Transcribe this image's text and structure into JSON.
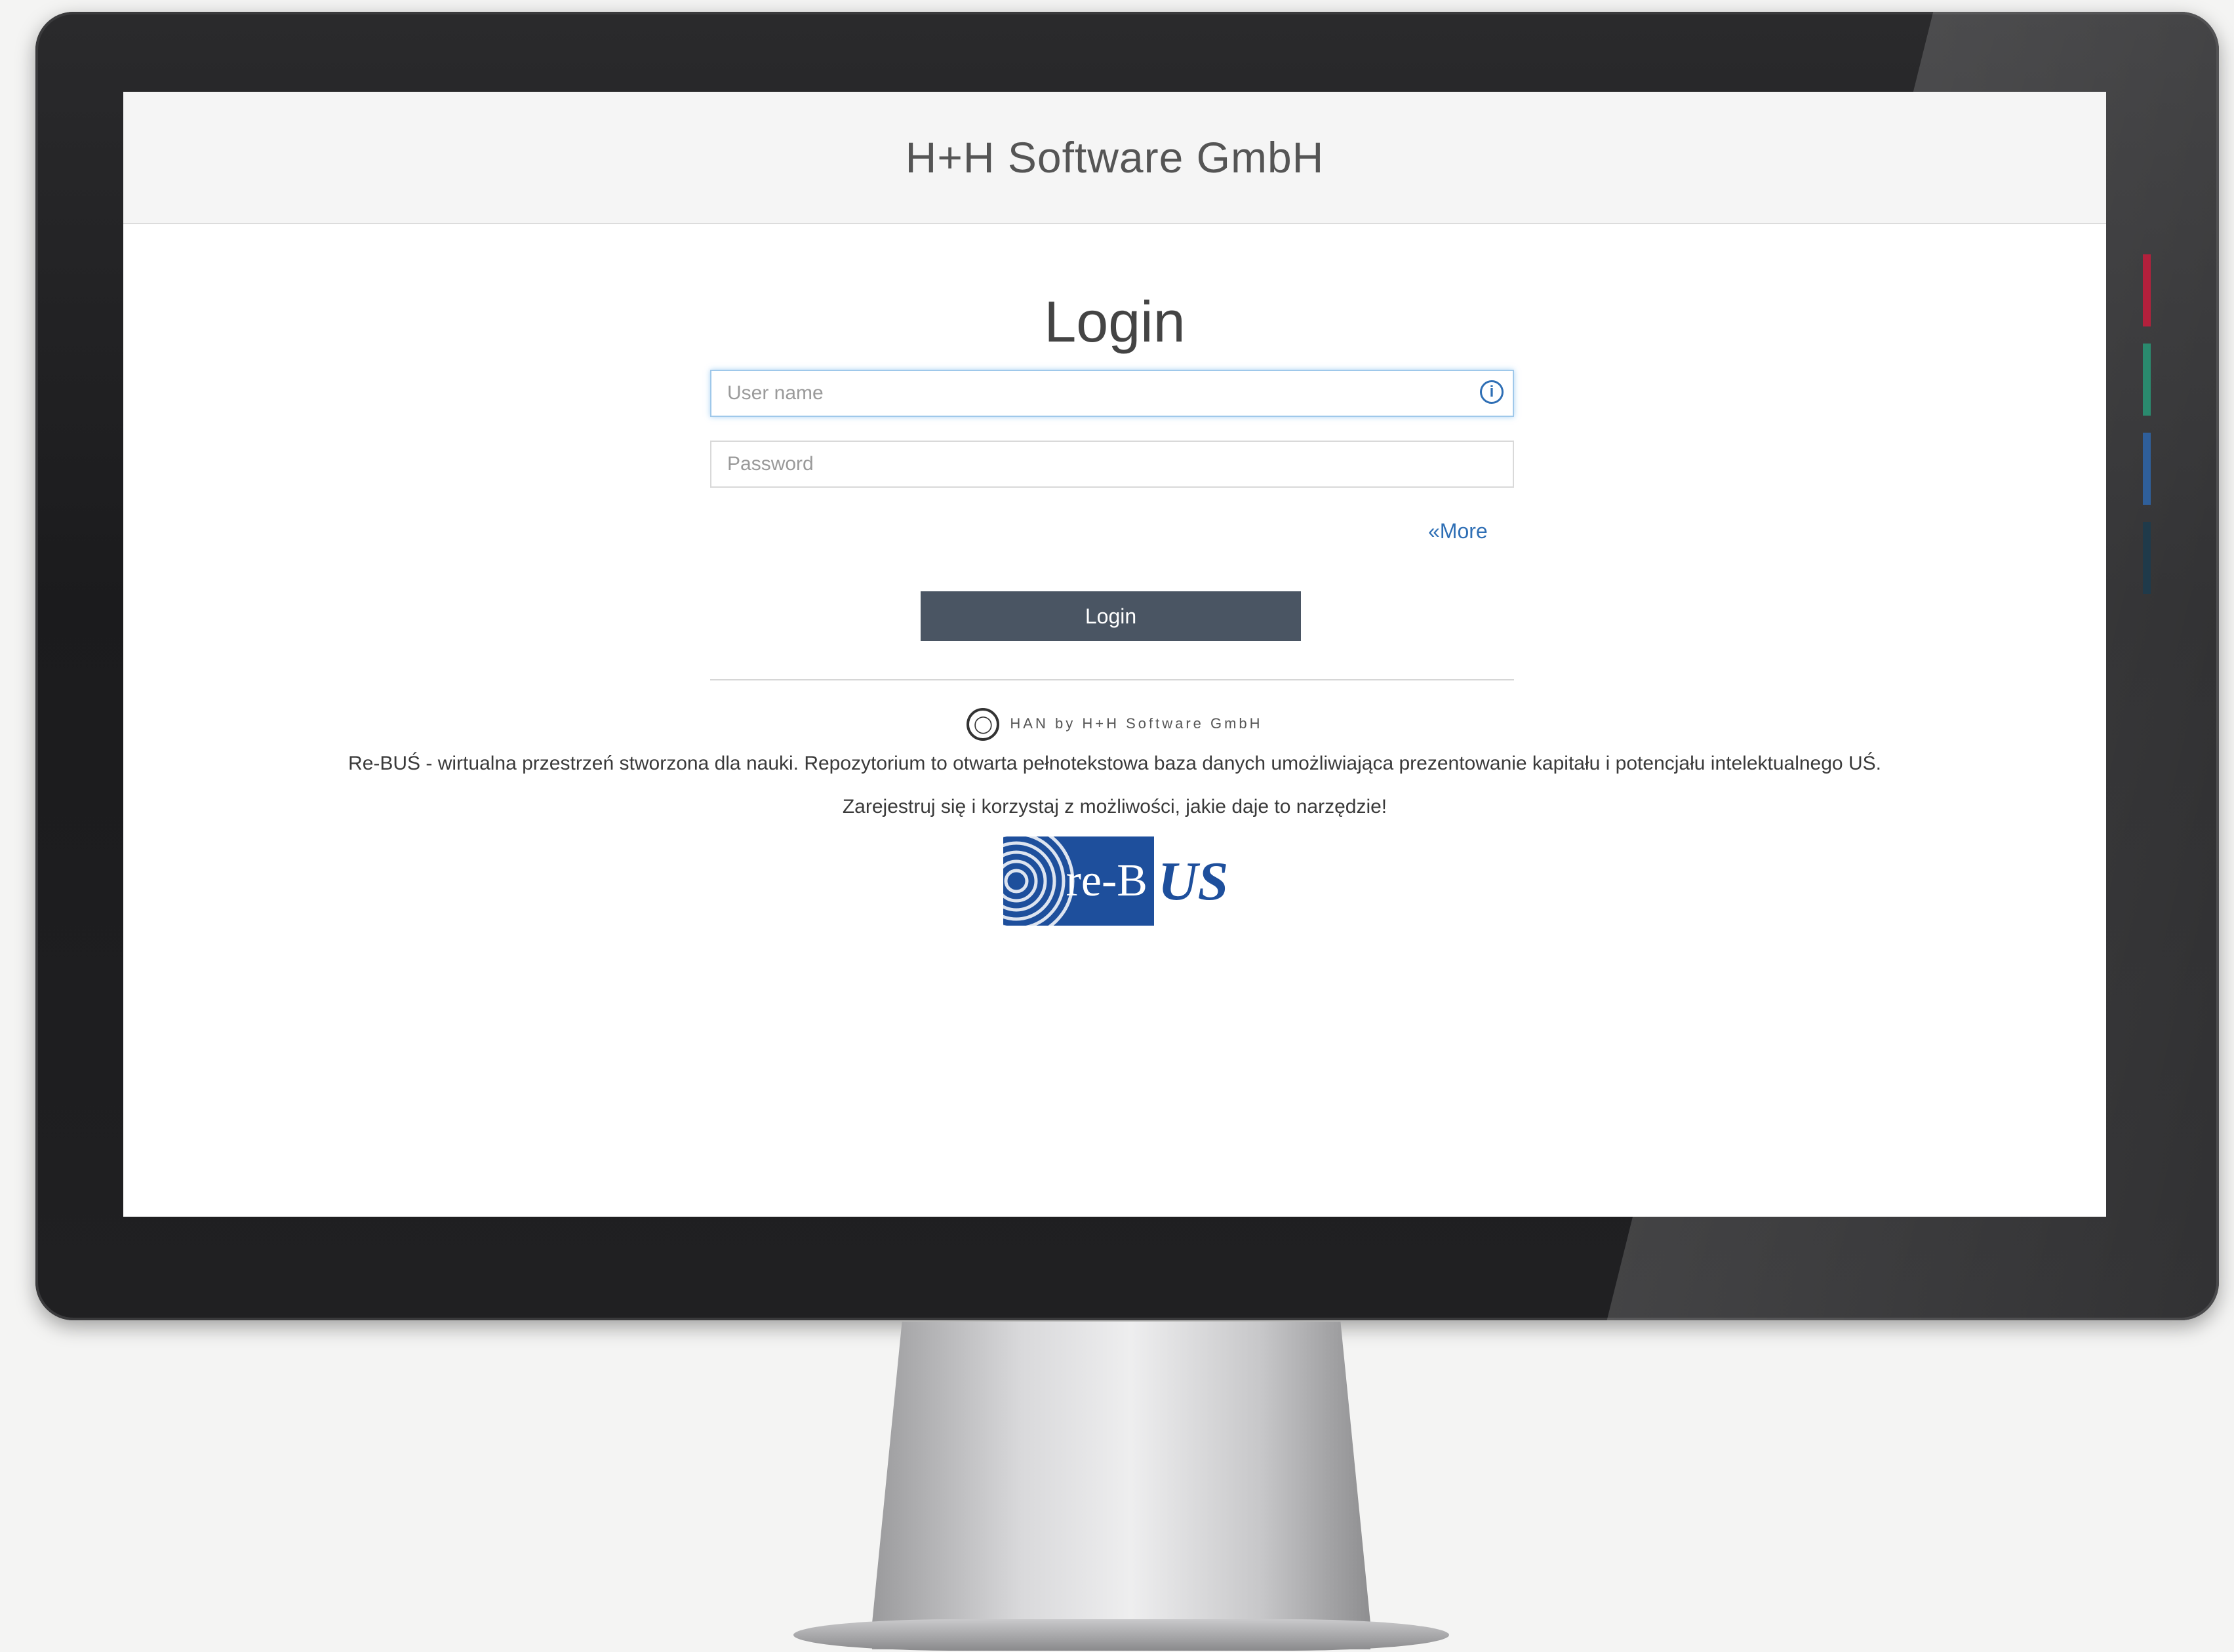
{
  "header": {
    "title": "H+H Software GmbH"
  },
  "login": {
    "title": "Login",
    "username_placeholder": "User name",
    "password_placeholder": "Password",
    "more_label": "«More",
    "button_label": "Login"
  },
  "footer": {
    "han_text": "HAN by H+H Software GmbH",
    "description_line1": "Re-BUŚ - wirtualna przestrzeń stworzona dla nauki. Repozytorium to otwarta pełnotekstowa baza danych umożliwiająca prezentowanie kapitału i potencjału intelektualnego UŚ.",
    "description_line2": "Zarejestruj się i korzystaj z możliwości, jakie daje to narzędzie!",
    "logo_text": "re-B",
    "logo_mark": "US"
  },
  "icons": {
    "info": "info-icon",
    "han_logo": "globe-icon",
    "more_chevron": "chevron-down-icon"
  },
  "colors": {
    "accent": "#2f6fb5",
    "button": "#4a5563",
    "logo_blue": "#1e4f9c",
    "side_tabs": [
      "#b3203c",
      "#2a8a6e",
      "#2f5f9a",
      "#1f3a4a"
    ]
  }
}
